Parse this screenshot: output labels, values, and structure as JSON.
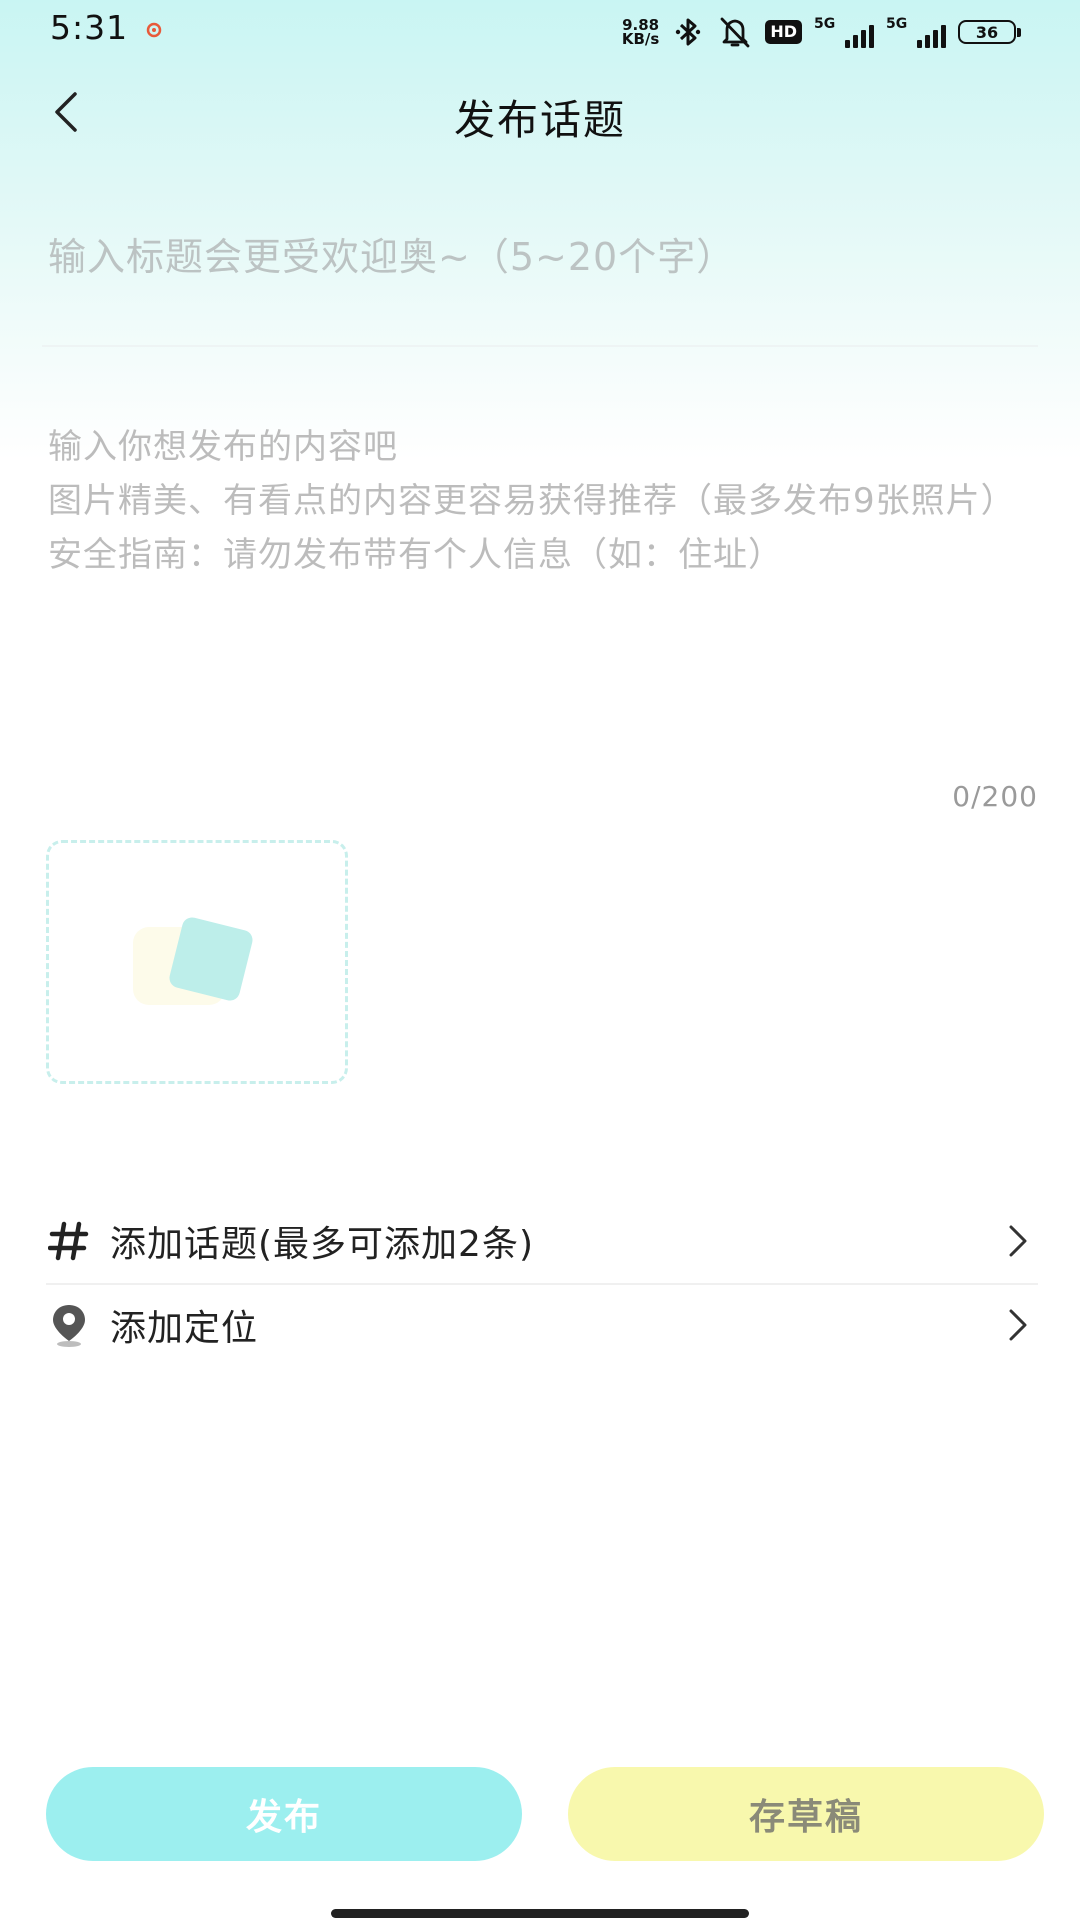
{
  "status_bar": {
    "time": "5:31",
    "net_speed_value": "9.88",
    "net_speed_unit": "KB/s",
    "hd_badge": "HD",
    "signal_1_label": "5G",
    "signal_2_label": "5G",
    "battery": "36"
  },
  "header": {
    "title": "发布话题"
  },
  "form": {
    "title_placeholder": "输入标题会更受欢迎奥~（5~20个字）",
    "content_placeholder": "输入你想发布的内容吧\n图片精美、有看点的内容更容易获得推荐（最多发布9张照片）\n安全指南：请勿发布带有个人信息（如：住址）",
    "char_count": "0/200"
  },
  "options": {
    "topic_label": "添加话题(最多可添加2条)",
    "location_label": "添加定位"
  },
  "actions": {
    "publish_label": "发布",
    "draft_label": "存草稿"
  },
  "colors": {
    "publish_button": "#9cefef",
    "draft_button": "#f8f8ad",
    "header_gradient": "#c9f5f3"
  }
}
